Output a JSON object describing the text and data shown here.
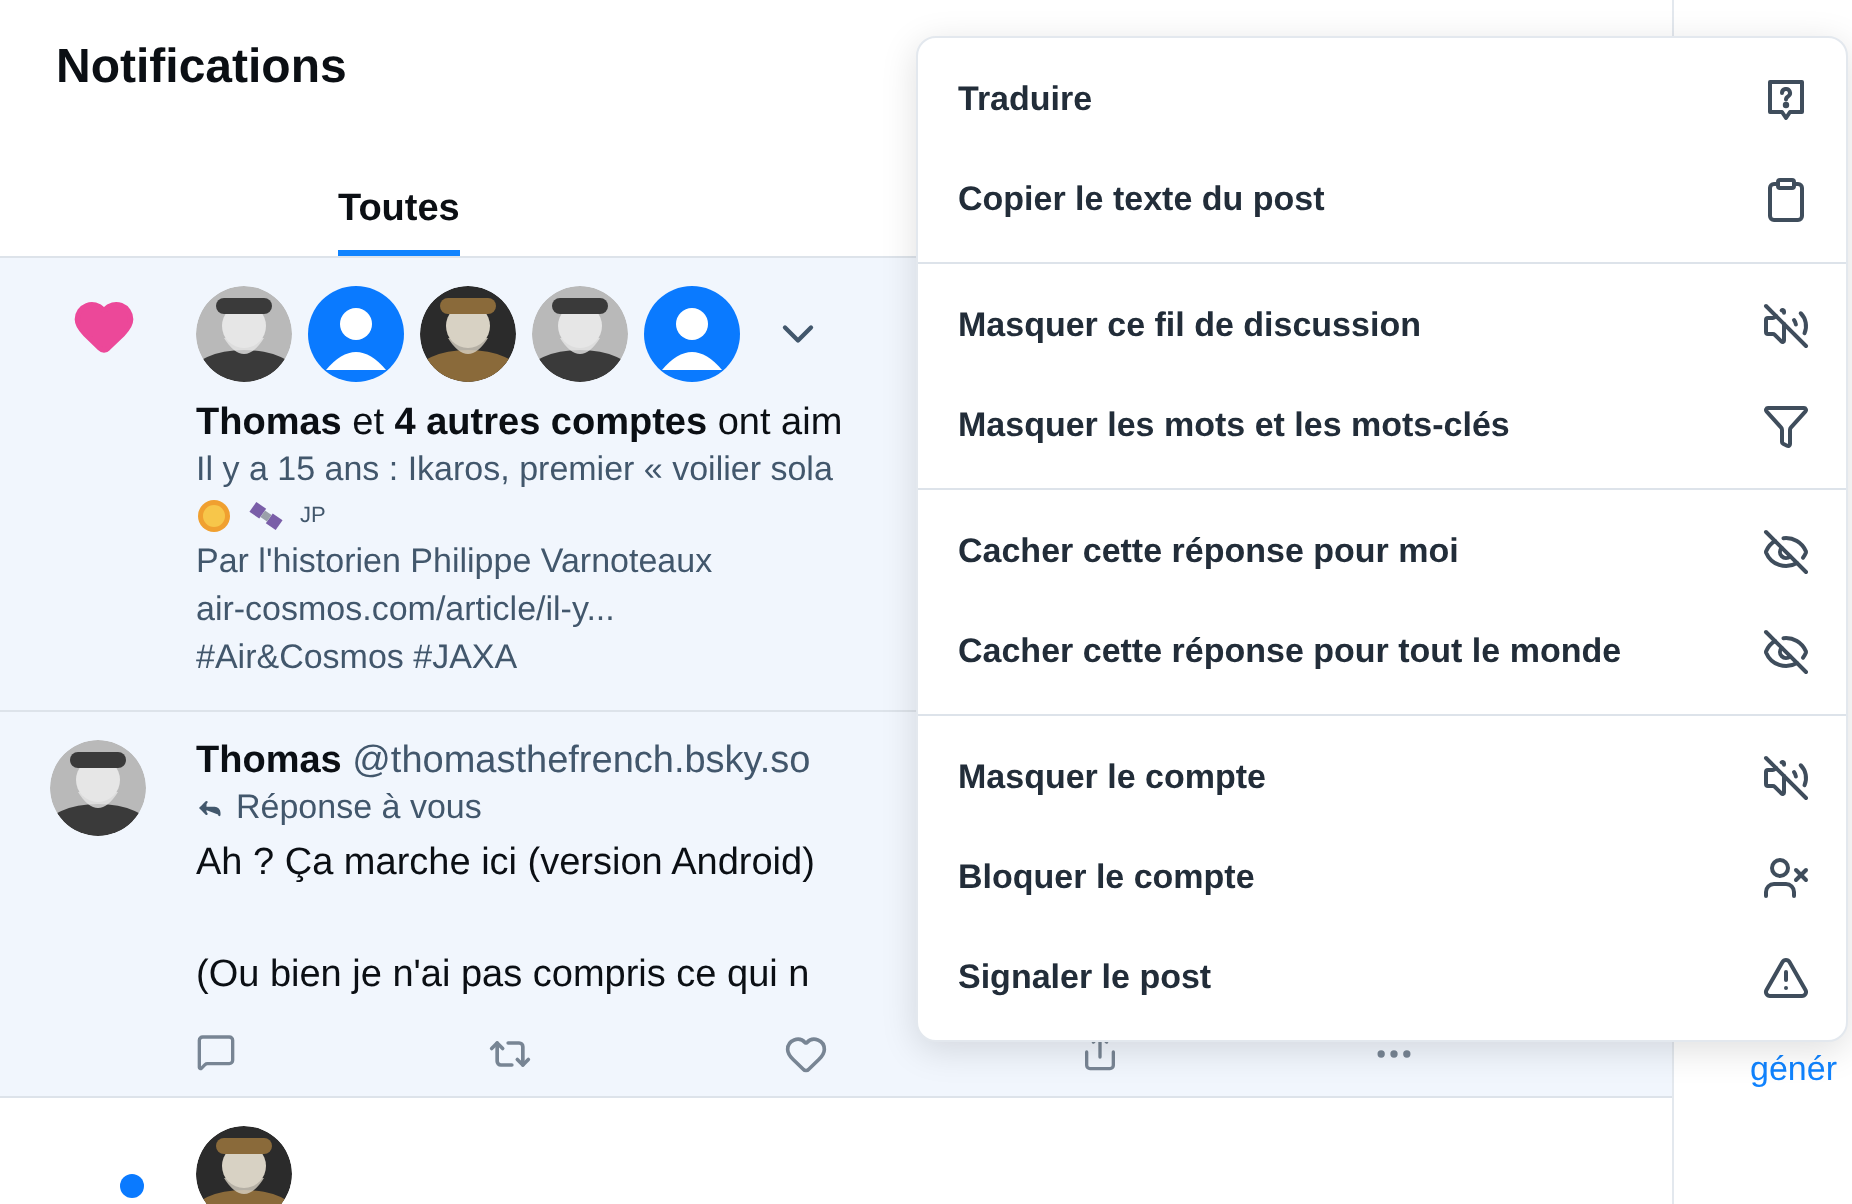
{
  "header": {
    "title": "Notifications"
  },
  "tabs": [
    {
      "label": "Toutes",
      "selected": true
    }
  ],
  "notifications": [
    {
      "kind": "like",
      "highlighted": true,
      "avatars": [
        {
          "kind": "picture"
        },
        {
          "kind": "default"
        },
        {
          "kind": "picture"
        },
        {
          "kind": "picture"
        },
        {
          "kind": "default"
        }
      ],
      "summary": "**Thomas** et **4 autres comptes** ont aim",
      "post_lines": [
        "Il y a 15 ans : Ikaros, premier « voilier sola"
      ],
      "tag": "JP",
      "more_lines": [
        "Par l'historien Philippe Varnoteaux",
        "air-cosmos.com/article/il-y...",
        "#Air&Cosmos #JAXA"
      ]
    },
    {
      "kind": "reply",
      "highlighted": true,
      "author": "Thomas",
      "handle": "@thomasthefrench.bsky.so",
      "reply_label": "Réponse à vous",
      "paragraphs": [
        "Ah ? Ça marche ici (version Android)",
        "(Ou bien je n'ai pas compris ce qui n"
      ]
    },
    {
      "kind": "partial",
      "highlighted": false,
      "unread": true
    }
  ],
  "menu": {
    "groups": [
      [
        {
          "label": "Traduire",
          "kind": "translate"
        },
        {
          "label": "Copier le texte du post",
          "kind": "copy"
        }
      ],
      [
        {
          "label": "Masquer ce fil de discussion",
          "kind": "mute"
        },
        {
          "label": "Masquer les mots et les mots-clés",
          "kind": "filter"
        }
      ],
      [
        {
          "label": "Cacher cette réponse pour moi",
          "kind": "hide"
        },
        {
          "label": "Cacher cette réponse pour tout le monde",
          "kind": "hide"
        }
      ],
      [
        {
          "label": "Masquer le compte",
          "kind": "mute"
        },
        {
          "label": "Bloquer le compte",
          "kind": "block"
        },
        {
          "label": "Signaler le post",
          "kind": "report"
        }
      ]
    ]
  },
  "sidebar": {
    "link": "génér"
  }
}
